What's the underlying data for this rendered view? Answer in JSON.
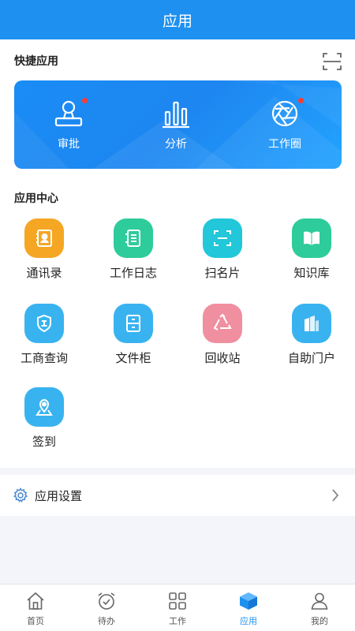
{
  "header": {
    "title": "应用"
  },
  "quick": {
    "title": "快捷应用",
    "scan_icon": "scan-icon",
    "items": [
      {
        "label": "审批",
        "icon": "stamp-icon",
        "badge": true
      },
      {
        "label": "分析",
        "icon": "bar-chart-icon",
        "badge": false
      },
      {
        "label": "工作圈",
        "icon": "aperture-icon",
        "badge": true
      }
    ],
    "banner_color": "#1e8ef5"
  },
  "app_center": {
    "title": "应用中心",
    "apps": [
      {
        "label": "通讯录",
        "icon": "contacts-icon",
        "color": "#f5a623"
      },
      {
        "label": "工作日志",
        "icon": "notebook-icon",
        "color": "#2ecc9a"
      },
      {
        "label": "扫名片",
        "icon": "scan-card-icon",
        "color": "#22c7d9"
      },
      {
        "label": "知识库",
        "icon": "book-icon",
        "color": "#2ecc9a"
      },
      {
        "label": "工商查询",
        "icon": "shield-icon",
        "color": "#39b3f0"
      },
      {
        "label": "文件柜",
        "icon": "cabinet-icon",
        "color": "#39b3f0"
      },
      {
        "label": "回收站",
        "icon": "recycle-icon",
        "color": "#f08fa0"
      },
      {
        "label": "自助门户",
        "icon": "building-icon",
        "color": "#39b3f0"
      },
      {
        "label": "签到",
        "icon": "location-icon",
        "color": "#39b3f0"
      }
    ]
  },
  "settings": {
    "label": "应用设置",
    "icon": "gear-icon"
  },
  "tabbar": {
    "active": "应用",
    "accent": "#1e90f0",
    "tabs": [
      {
        "label": "首页",
        "icon": "home-icon"
      },
      {
        "label": "待办",
        "icon": "alarm-clock-icon"
      },
      {
        "label": "工作",
        "icon": "grid-icon"
      },
      {
        "label": "应用",
        "icon": "cube-icon"
      },
      {
        "label": "我的",
        "icon": "person-icon"
      }
    ]
  }
}
